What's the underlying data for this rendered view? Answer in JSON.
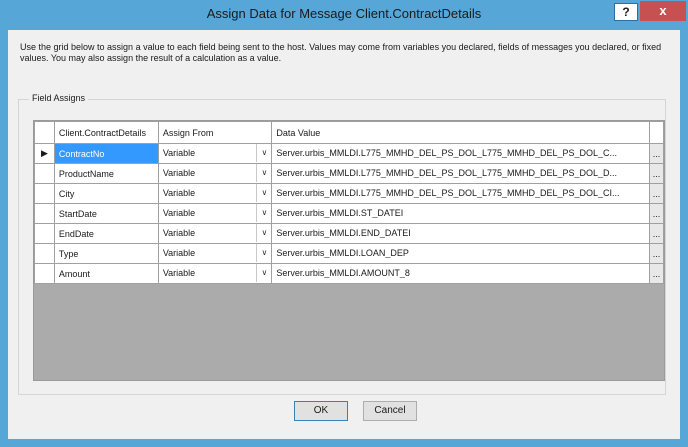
{
  "window": {
    "title": "Assign Data for Message Client.ContractDetails",
    "help_label": "?",
    "close_label": "x"
  },
  "description": "Use the grid below to assign a value to each field being sent to the host. Values may come from variables you declared, fields of messages you declared, or fixed values. You may also  assign the result of a calculation as a value.",
  "field_assigns": {
    "group_label": "Field Assigns",
    "columns": [
      "Client.ContractDetails",
      "Assign From",
      "Data Value"
    ],
    "current_row_marker": "▶",
    "ellipsis_label": "...",
    "dropdown_arrow": "∨",
    "rows": [
      {
        "field": "ContractNo",
        "assign_from": "Variable",
        "data_value": "Server.urbis_MMLDI.L775_MMHD_DEL_PS_DOL_L775_MMHD_DEL_PS_DOL_C..."
      },
      {
        "field": "ProductName",
        "assign_from": "Variable",
        "data_value": "Server.urbis_MMLDI.L775_MMHD_DEL_PS_DOL_L775_MMHD_DEL_PS_DOL_D..."
      },
      {
        "field": "City",
        "assign_from": "Variable",
        "data_value": "Server.urbis_MMLDI.L775_MMHD_DEL_PS_DOL_L775_MMHD_DEL_PS_DOL_CI..."
      },
      {
        "field": "StartDate",
        "assign_from": "Variable",
        "data_value": "Server.urbis_MMLDI.ST_DATEI"
      },
      {
        "field": "EndDate",
        "assign_from": "Variable",
        "data_value": "Server.urbis_MMLDI.END_DATEI"
      },
      {
        "field": "Type",
        "assign_from": "Variable",
        "data_value": "Server.urbis_MMLDI.LOAN_DEP"
      },
      {
        "field": "Amount",
        "assign_from": "Variable",
        "data_value": "Server.urbis_MMLDI.AMOUNT_8"
      }
    ]
  },
  "buttons": {
    "ok": "OK",
    "cancel": "Cancel"
  }
}
